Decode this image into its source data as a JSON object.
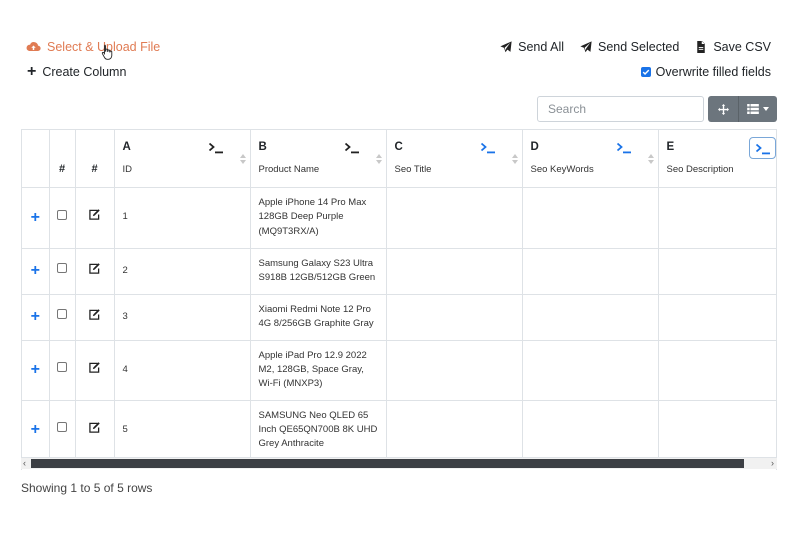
{
  "toolbar": {
    "upload_label": "Select & Upload File",
    "create_column_label": "Create Column",
    "send_all_label": "Send All",
    "send_selected_label": "Send Selected",
    "save_csv_label": "Save CSV",
    "overwrite_label": "Overwrite filled fields",
    "overwrite_checked": true
  },
  "search": {
    "placeholder": "Search"
  },
  "table": {
    "narrow_headers": [
      "",
      "#",
      "#"
    ],
    "columns": [
      {
        "letter": "A",
        "name": "ID"
      },
      {
        "letter": "B",
        "name": "Product Name"
      },
      {
        "letter": "C",
        "name": "Seo Title"
      },
      {
        "letter": "D",
        "name": "Seo KeyWords"
      },
      {
        "letter": "E",
        "name": "Seo Description"
      }
    ],
    "rows": [
      {
        "id": "1",
        "product": "Apple iPhone 14 Pro Max 128GB Deep Purple (MQ9T3RX/A)",
        "seo_title": "",
        "seo_keywords": "",
        "seo_description": ""
      },
      {
        "id": "2",
        "product": "Samsung Galaxy S23 Ultra S918B 12GB/512GB Green",
        "seo_title": "",
        "seo_keywords": "",
        "seo_description": ""
      },
      {
        "id": "3",
        "product": "Xiaomi Redmi Note 12 Pro 4G 8/256GB Graphite Gray",
        "seo_title": "",
        "seo_keywords": "",
        "seo_description": ""
      },
      {
        "id": "4",
        "product": "Apple iPad Pro 12.9 2022 M2, 128GB, Space Gray, Wi-Fi (MNXP3)",
        "seo_title": "",
        "seo_keywords": "",
        "seo_description": ""
      },
      {
        "id": "5",
        "product": "SAMSUNG Neo QLED 65 Inch QE65QN700B 8K UHD Grey Anthracite",
        "seo_title": "",
        "seo_keywords": "",
        "seo_description": ""
      }
    ]
  },
  "pagination": {
    "info": "Showing 1 to 5 of 5 rows"
  },
  "colors": {
    "accent": "#e07b53",
    "primary": "#1a73e8",
    "button_gray": "#6c757d"
  }
}
